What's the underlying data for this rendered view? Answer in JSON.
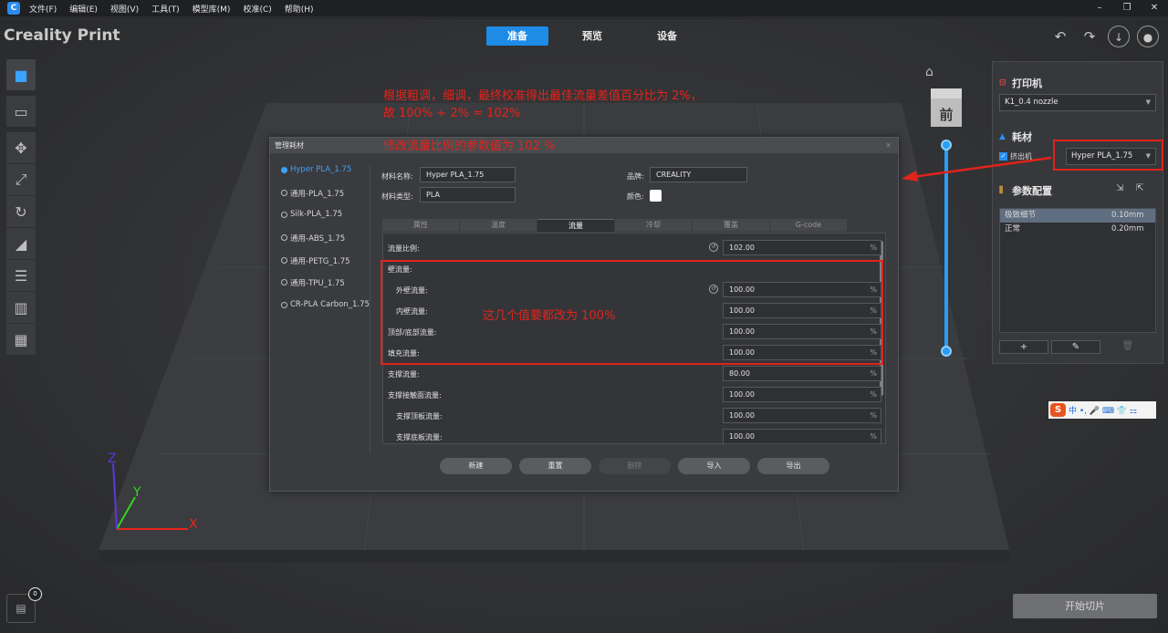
{
  "menu": {
    "items": [
      "文件(F)",
      "编辑(E)",
      "视图(V)",
      "工具(T)",
      "模型库(M)",
      "校准(C)",
      "帮助(H)"
    ]
  },
  "app_title": "Creality Print",
  "top_tabs": [
    "准备",
    "预览",
    "设备"
  ],
  "active_tab": "准备",
  "view_cube_label": "前",
  "right_panel": {
    "printer_title": "打印机",
    "printer_value": "K1_0.4 nozzle",
    "filament_title": "耗材",
    "extruder_label": "挤出机",
    "filament_value": "Hyper PLA_1.75",
    "profile_title": "参数配置",
    "profiles": [
      {
        "name": "极致细节",
        "value": "0.10mm"
      },
      {
        "name": "正常",
        "value": "0.20mm"
      }
    ],
    "add_label": "+"
  },
  "ime": {
    "s": "S",
    "text": "中 •, 🎤 ⌨ 👕 ⚏"
  },
  "slice_button": "开始切片",
  "file_count": "0",
  "dialog": {
    "title": "管理耗材",
    "materials": [
      "Hyper PLA_1.75",
      "通用-PLA_1.75",
      "Silk-PLA_1.75",
      "通用-ABS_1.75",
      "通用-PETG_1.75",
      "通用-TPU_1.75",
      "CR-PLA Carbon_1.75"
    ],
    "selected_material": "Hyper PLA_1.75",
    "name_label": "材料名称:",
    "name_value": "Hyper PLA_1.75",
    "type_label": "材料类型:",
    "type_value": "PLA",
    "brand_label": "品牌:",
    "brand_value": "CREALITY",
    "color_label": "颜色:",
    "color_value": "#ffffff",
    "tabs": [
      "属性",
      "温度",
      "流量",
      "冷却",
      "覆盖",
      "G-code"
    ],
    "active_tab": "流量",
    "rows": [
      {
        "label": "流量比例:",
        "value": "102.00",
        "unit": "%",
        "reset": true,
        "indent": false
      },
      {
        "label": "壁流量:",
        "value": "",
        "unit": "",
        "reset": false,
        "indent": false
      },
      {
        "label": "外壁流量:",
        "value": "100.00",
        "unit": "%",
        "reset": true,
        "indent": true
      },
      {
        "label": "内壁流量:",
        "value": "100.00",
        "unit": "%",
        "reset": false,
        "indent": true
      },
      {
        "label": "顶部/底部流量:",
        "value": "100.00",
        "unit": "%",
        "reset": false,
        "indent": false
      },
      {
        "label": "填充流量:",
        "value": "100.00",
        "unit": "%",
        "reset": false,
        "indent": false
      },
      {
        "label": "支撑流量:",
        "value": "80.00",
        "unit": "%",
        "reset": false,
        "indent": false
      },
      {
        "label": "支撑接触面流量:",
        "value": "100.00",
        "unit": "%",
        "reset": false,
        "indent": false
      },
      {
        "label": "支撑顶板流量:",
        "value": "100.00",
        "unit": "%",
        "reset": false,
        "indent": true
      },
      {
        "label": "支撑底板流量:",
        "value": "100.00",
        "unit": "%",
        "reset": false,
        "indent": true
      }
    ],
    "buttons": [
      "新建",
      "重置",
      "删除",
      "导入",
      "导出"
    ]
  },
  "annotations": {
    "line1": "根据粗调，细调，最终校准得出最佳流量差值百分比为 2%，",
    "line2": "故 100% + 2% = 102%",
    "line3": "修改流量比例的参数值为 102 %",
    "line4": "这几个值要都改为 100%"
  },
  "axis_labels": {
    "x": "X",
    "y": "Y",
    "z": "Z"
  },
  "colors": {
    "accent": "#1e8be6",
    "annotation": "#e6221b",
    "axis_x": "#e8251c",
    "axis_y": "#2fd61f",
    "axis_z": "#5b38e0"
  }
}
